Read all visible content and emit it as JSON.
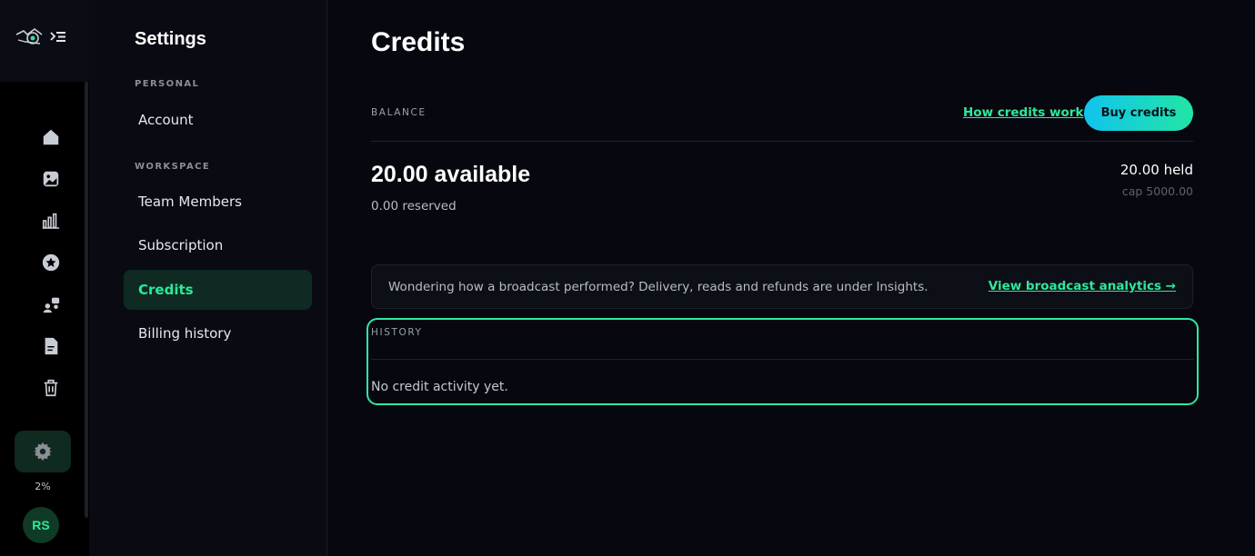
{
  "rail": {
    "nav_icons": [
      "home-icon",
      "image-icon",
      "chart-icon",
      "star-icon",
      "users-icon",
      "document-icon",
      "trash-icon"
    ],
    "settings_icon": "gear-icon",
    "usage_percent": "2%",
    "avatar_initials": "RS"
  },
  "settings": {
    "title": "Settings",
    "personal_label": "PERSONAL",
    "workspace_label": "WORKSPACE",
    "items": [
      {
        "label": "Account",
        "active": false
      },
      {
        "label": "Team Members",
        "active": false
      },
      {
        "label": "Subscription",
        "active": false
      },
      {
        "label": "Credits",
        "active": true
      },
      {
        "label": "Billing history",
        "active": false
      }
    ]
  },
  "main": {
    "title": "Credits",
    "balance_label": "BALANCE",
    "how_link": "How credits work",
    "buy_button": "Buy credits",
    "available": "20.00 available",
    "reserved": "0.00 reserved",
    "held": "20.00 held",
    "cap": "cap 5000.00",
    "info_text": "Wondering how a broadcast performed? Delivery, reads and refunds are under Insights.",
    "analytics_link": "View broadcast analytics →",
    "history_label": "HISTORY",
    "history_empty": "No credit activity yet."
  },
  "colors": {
    "accent": "#2ee89a",
    "background": "#07080f",
    "buy_gradient_start": "#10c4ee",
    "buy_gradient_end": "#22e5a4"
  }
}
